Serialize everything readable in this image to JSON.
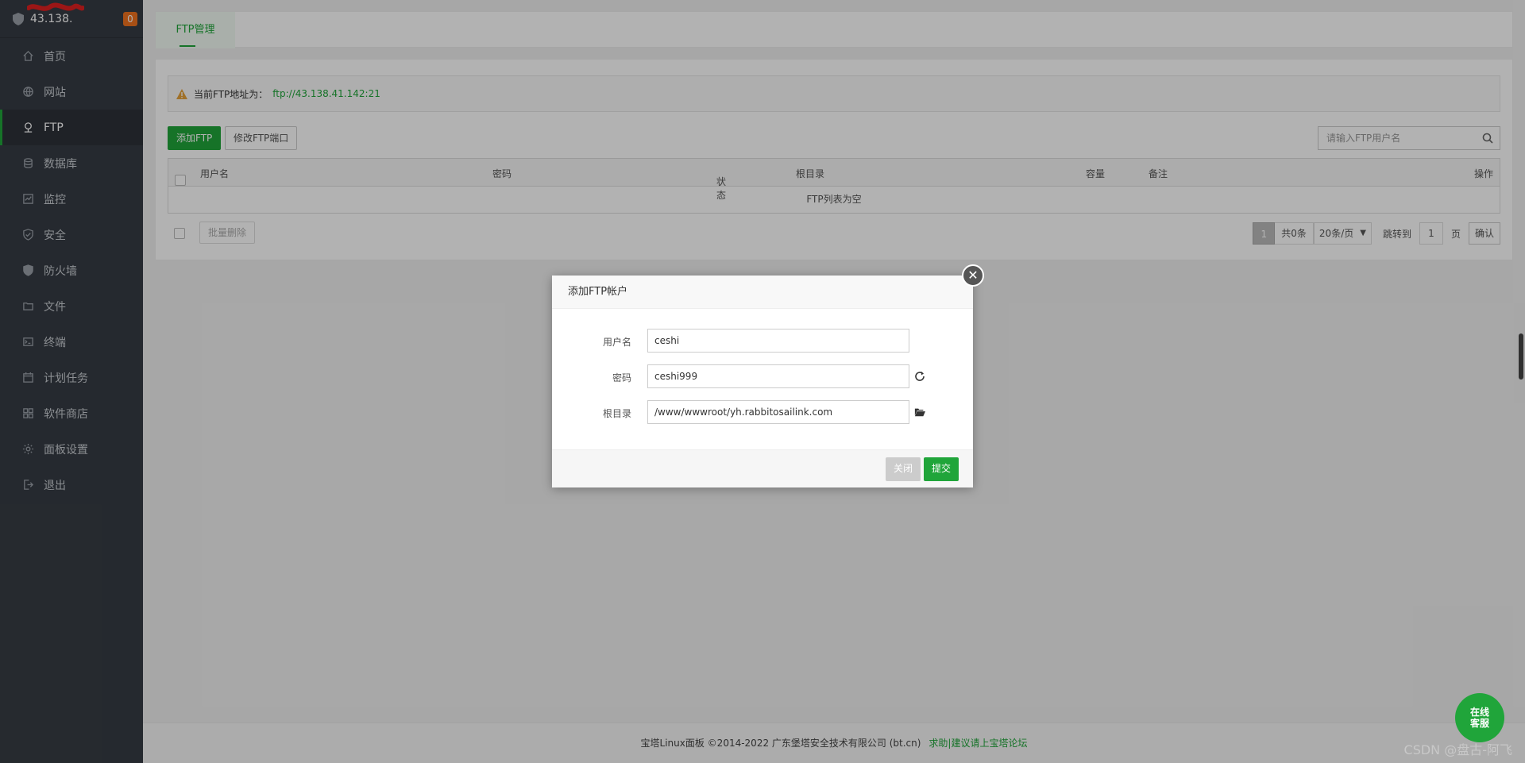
{
  "sidebar": {
    "server_ip": "43.138.",
    "notice_count": "0",
    "items": [
      {
        "label": "首页",
        "icon": "home-icon"
      },
      {
        "label": "网站",
        "icon": "globe-icon"
      },
      {
        "label": "FTP",
        "icon": "ftp-icon",
        "active": true
      },
      {
        "label": "数据库",
        "icon": "database-icon"
      },
      {
        "label": "监控",
        "icon": "monitor-icon"
      },
      {
        "label": "安全",
        "icon": "shield-check-icon"
      },
      {
        "label": "防火墙",
        "icon": "firewall-icon"
      },
      {
        "label": "文件",
        "icon": "folder-icon"
      },
      {
        "label": "终端",
        "icon": "terminal-icon"
      },
      {
        "label": "计划任务",
        "icon": "calendar-icon"
      },
      {
        "label": "软件商店",
        "icon": "apps-grid-icon"
      },
      {
        "label": "面板设置",
        "icon": "settings-icon"
      },
      {
        "label": "退出",
        "icon": "logout-icon"
      }
    ]
  },
  "tabs": {
    "ftp_manage": "FTP管理"
  },
  "alert": {
    "label": "当前FTP地址为：",
    "address": "ftp://43.138.41.142:21"
  },
  "toolbar": {
    "add_ftp": "添加FTP",
    "modify_port": "修改FTP端口"
  },
  "search": {
    "placeholder": "请输入FTP用户名"
  },
  "table": {
    "columns": {
      "username": "用户名",
      "password": "密码",
      "status": "状态",
      "root_dir": "根目录",
      "capacity": "容量",
      "remark": "备注",
      "action": "操作"
    },
    "empty_text": "FTP列表为空"
  },
  "bulk": {
    "delete": "批量删除"
  },
  "pagination": {
    "current": "1",
    "total": "共0条",
    "per_page": "20条/页",
    "jump_label": "跳转到",
    "jump_value": "1",
    "page_unit": "页",
    "confirm": "确认"
  },
  "footer": {
    "copyright": "宝塔Linux面板 ©2014-2022 广东堡塔安全技术有限公司 (bt.cn)",
    "forum_link": "求助|建议请上宝塔论坛"
  },
  "online_service": {
    "line1": "在线",
    "line2": "客服"
  },
  "watermark": "CSDN @盘古-阿飞",
  "modal": {
    "title": "添加FTP帐户",
    "fields": {
      "username_label": "用户名",
      "username_value": "ceshi",
      "password_label": "密码",
      "password_value": "ceshi999",
      "path_label": "根目录",
      "path_value": "/www/wwwroot/yh.rabbitosailink.com"
    },
    "close_button": "关闭",
    "submit_button": "提交"
  },
  "colors": {
    "accent": "#20a53a",
    "sidebar_bg": "#363c44",
    "badge": "#f0711f"
  }
}
